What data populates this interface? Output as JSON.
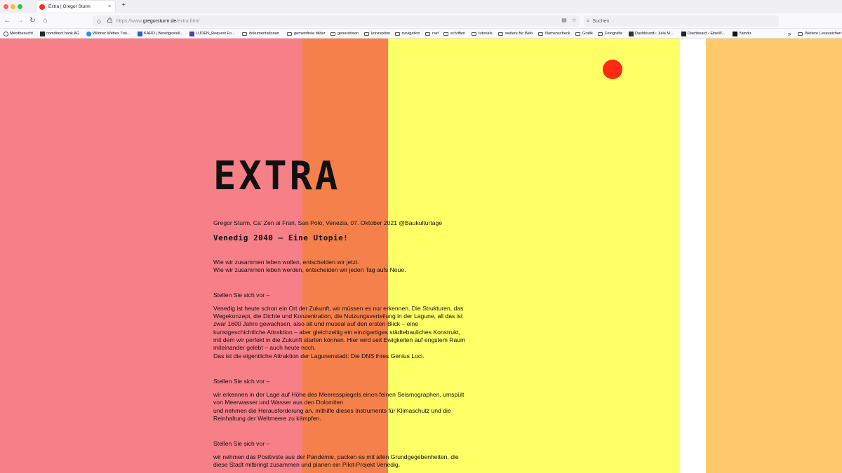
{
  "browser": {
    "tab_title": "Extra | Gregor Sturm",
    "tab_close": "×",
    "new_tab": "+",
    "url_prefix": "https://www.",
    "url_host": "gregorsturm.de",
    "url_path": "/extra.html",
    "search_placeholder": "Suchen",
    "icons": {
      "back": "←",
      "forward": "→",
      "reload": "↻",
      "home": "⌂",
      "shield": "◇",
      "lock": "🔒",
      "reader": "▤",
      "star": "☆",
      "search": "⌕"
    }
  },
  "bookmarks": [
    {
      "label": "Meistbesucht",
      "icon": "gear"
    },
    {
      "label": "comdirect bank AG",
      "icon": "site"
    },
    {
      "label": "Wildner Webex Trai...",
      "icon": "site"
    },
    {
      "label": "KARO | Bereitgestell...",
      "icon": "site"
    },
    {
      "label": "LUDEN_Request Fo...",
      "icon": "site"
    },
    {
      "label": "dokumentationen",
      "icon": "folder"
    },
    {
      "label": "gemeinfreie bilder",
      "icon": "folder"
    },
    {
      "label": "generatoren",
      "icon": "folder"
    },
    {
      "label": "konzeption",
      "icon": "folder"
    },
    {
      "label": "navigation",
      "icon": "folder"
    },
    {
      "label": "rwd",
      "icon": "folder"
    },
    {
      "label": "schriften",
      "icon": "folder"
    },
    {
      "label": "tutorials",
      "icon": "folder"
    },
    {
      "label": "weitere für Web",
      "icon": "folder"
    },
    {
      "label": "Namenscheck",
      "icon": "folder"
    },
    {
      "label": "Grafik",
      "icon": "folder"
    },
    {
      "label": "Fotografie",
      "icon": "folder"
    },
    {
      "label": "Dashboard ‹ Julia M...",
      "icon": "site"
    },
    {
      "label": "Dashboard ‹ EineW...",
      "icon": "site"
    },
    {
      "label": "Yamdu",
      "icon": "site"
    }
  ],
  "bookmarks_overflow": "»",
  "bookmarks_other": "Weitere Lesezeichen",
  "page": {
    "title": "EXTRA",
    "byline": "Gregor Sturm, Ca’ Zen ai Frari, San Polo, Venezia, 07. Oktober 2021 @Baukulturtage",
    "subtitle": "Venedig 2040 – Eine Utopie!",
    "intro_1": "Wie wir zusammen leben wollen, entscheiden wir jetzt.",
    "intro_2": "Wie wir zusammen leben werden, entscheiden wir jeden Tag aufs Neue.",
    "prompt_1": "Stellen Sie sich vor –",
    "body_1": "Venedig ist heute schon ein Ort der Zukunft, wir müssen es nur erkennen. Die Strukturen, das Wegekonzept, die Dichte und Konzentration, die Nutzungsverteilung in der Lagune, all das ist zwar 1600 Jahre gewachsen, also alt und museal auf den ersten Blick – eine kunstgeschichtliche Attraktion – aber gleichzeitig ein einzigartiges städtebauliches Konstrukt, mit dem wir perfekt in die Zukunft starten können. Hier wird seit Ewigkeiten auf engstem Raum miteinander gelebt – auch heute noch.",
    "body_1b": "Das ist die eigentliche Attraktion der Lagunenstadt: Die DNS ihres Genius Loci.",
    "prompt_2": "Stellen Sie sich vor –",
    "body_2": "wir erkennen in der Lage auf Höhe des Meeresspiegels einen feinen Seismographen, umspült von Meerwasser und Wasser aus den Dolomiten",
    "body_2b": "und nehmen die Herausforderung an, mithilfe dieses Instruments für Klimaschutz und die Reinhaltung der Weltmeere zu kämpfen.",
    "prompt_3": "Stellen Sie sich vor –",
    "body_3": "wir nehmen das Positivste aus der Pandemie, packen es mit allen Grundgegebenheiten, die diese Stadt mitbringt zusammen und planen ein Pilot-Projekt Venedig."
  },
  "colors": {
    "stripe_pink": "#f77f87",
    "stripe_orange": "#f6804b",
    "stripe_yellow": "#ffff66",
    "stripe_white": "#ffffff",
    "stripe_peach": "#fec96b",
    "dot_red": "#ff2a12"
  }
}
